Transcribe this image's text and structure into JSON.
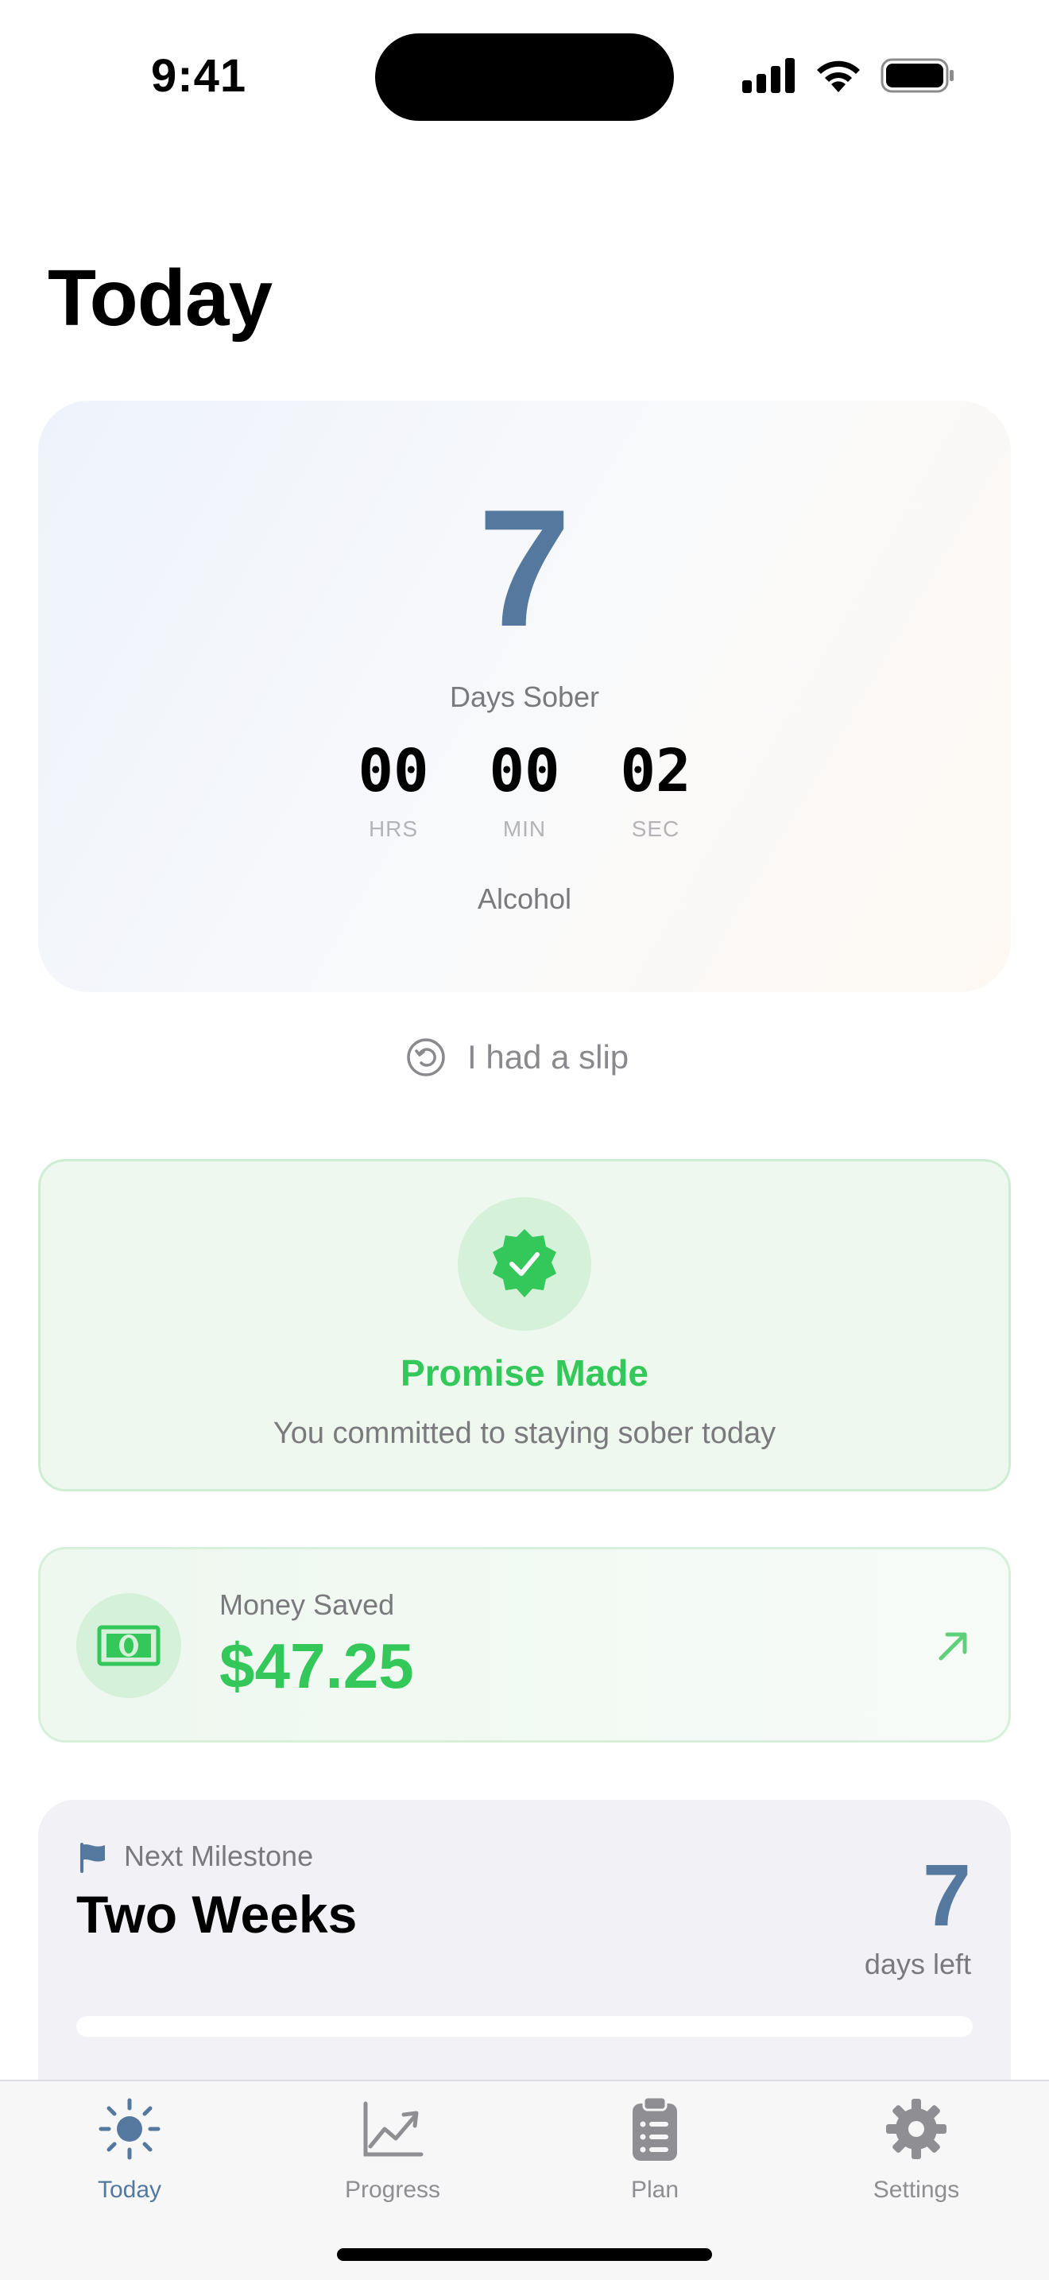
{
  "status_bar": {
    "time": "9:41"
  },
  "page": {
    "title": "Today"
  },
  "counter": {
    "days": "7",
    "days_label": "Days Sober",
    "hours": "00",
    "minutes": "00",
    "seconds": "02",
    "hours_label": "HRS",
    "minutes_label": "MIN",
    "seconds_label": "SEC",
    "substance": "Alcohol"
  },
  "slip": {
    "label": "I had a slip"
  },
  "promise": {
    "title": "Promise Made",
    "subtitle": "You committed to staying sober today"
  },
  "money": {
    "label": "Money Saved",
    "value": "$47.25"
  },
  "milestone": {
    "label": "Next Milestone",
    "title": "Two Weeks",
    "days_left": "7",
    "days_left_label": "days left",
    "progress_percent": 0
  },
  "tabs": [
    {
      "label": "Today",
      "icon": "sun-icon",
      "active": true
    },
    {
      "label": "Progress",
      "icon": "chart-icon",
      "active": false
    },
    {
      "label": "Plan",
      "icon": "clipboard-icon",
      "active": false
    },
    {
      "label": "Settings",
      "icon": "gear-icon",
      "active": false
    }
  ],
  "colors": {
    "accent": "#55799e",
    "success": "#34c759",
    "secondary_text": "#7a7a7e"
  }
}
